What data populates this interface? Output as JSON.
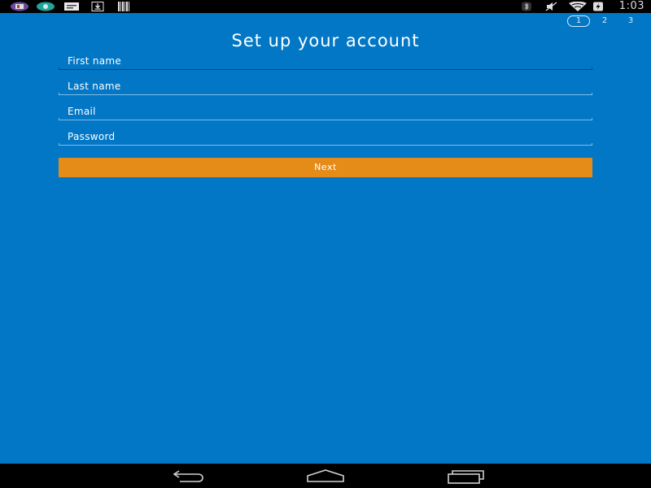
{
  "status_bar": {
    "time": "1:03",
    "left_icons": [
      "app-icon",
      "chat-icon",
      "messages-icon",
      "download-icon",
      "barcode-icon"
    ],
    "right_icons": [
      "bluetooth-icon",
      "mute-icon",
      "wifi-icon",
      "battery-charging-icon"
    ]
  },
  "steps": [
    {
      "label": "1",
      "active": true
    },
    {
      "label": "2",
      "active": false
    },
    {
      "label": "3",
      "active": false
    }
  ],
  "title": "Set up your account",
  "form": {
    "first_name_label": "First name",
    "last_name_label": "Last name",
    "email_label": "Email",
    "password_label": "Password",
    "next_label": "Next"
  },
  "navigation": [
    "back-icon",
    "home-icon",
    "recents-icon"
  ],
  "colors": {
    "background": "#0277c6",
    "button": "#e58c18",
    "status_bar": "#000000"
  }
}
